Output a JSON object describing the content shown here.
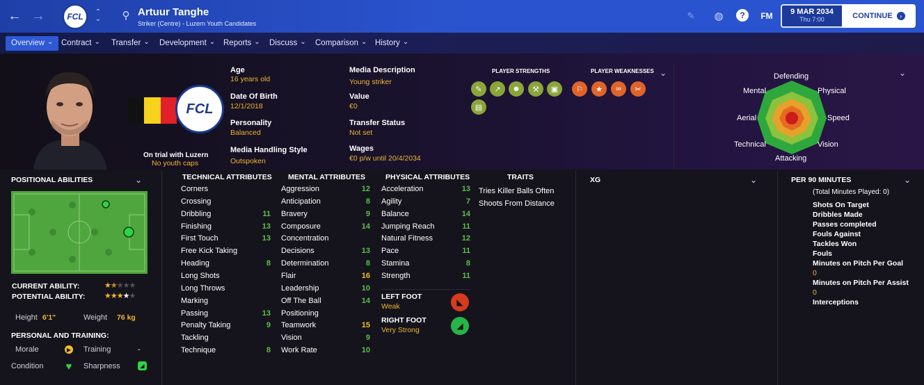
{
  "header": {
    "player_name": "Artuur Tanghe",
    "subtitle": "Striker (Centre) - Luzern Youth Candidates",
    "club_badge_text": "FCL",
    "date": "9 MAR 2034",
    "time": "Thu 7:00",
    "continue_label": "CONTINUE",
    "fm_label": "FM"
  },
  "tabs": [
    "Overview",
    "Contract",
    "Transfer",
    "Development",
    "Reports",
    "Discuss",
    "Comparison",
    "History"
  ],
  "profile": {
    "trial_label": "On trial with Luzern",
    "caps": "No youth caps",
    "age_label": "Age",
    "age": "16 years old",
    "dob_label": "Date Of Birth",
    "dob": "12/1/2018",
    "personality_label": "Personality",
    "personality": "Balanced",
    "media_style_label": "Media Handling Style",
    "media_style": "Outspoken",
    "media_desc_label": "Media Description",
    "media_desc": "Young striker",
    "value_label": "Value",
    "value": "€0",
    "transfer_status_label": "Transfer Status",
    "transfer_status": "Not set",
    "wages_label": "Wages",
    "wages": "€0 p/w until 20/4/2034",
    "strengths_label": "PLAYER STRENGTHS",
    "weaknesses_label": "PLAYER WEAKNESSES"
  },
  "radar": {
    "labels": [
      "Defending",
      "Physical",
      "Speed",
      "Vision",
      "Attacking",
      "Technical",
      "Aerial",
      "Mental"
    ]
  },
  "positional": {
    "title": "POSITIONAL ABILITIES",
    "current_ability_label": "CURRENT ABILITY:",
    "potential_ability_label": "POTENTIAL ABILITY:",
    "current_stars": 1.5,
    "potential_stars": 3.5,
    "height_label": "Height",
    "height": "6'1\"",
    "weight_label": "Weight",
    "weight": "76 kg",
    "personal_title": "PERSONAL AND TRAINING:",
    "morale_label": "Morale",
    "training_label": "Training",
    "training": "-",
    "condition_label": "Condition",
    "sharpness_label": "Sharpness"
  },
  "technical": {
    "title": "TECHNICAL ATTRIBUTES",
    "items": [
      {
        "name": "Corners",
        "value": ""
      },
      {
        "name": "Crossing",
        "value": ""
      },
      {
        "name": "Dribbling",
        "value": "11"
      },
      {
        "name": "Finishing",
        "value": "13"
      },
      {
        "name": "First Touch",
        "value": "13"
      },
      {
        "name": "Free Kick Taking",
        "value": ""
      },
      {
        "name": "Heading",
        "value": "8"
      },
      {
        "name": "Long Shots",
        "value": ""
      },
      {
        "name": "Long Throws",
        "value": ""
      },
      {
        "name": "Marking",
        "value": ""
      },
      {
        "name": "Passing",
        "value": "13"
      },
      {
        "name": "Penalty Taking",
        "value": "9"
      },
      {
        "name": "Tackling",
        "value": ""
      },
      {
        "name": "Technique",
        "value": "8"
      }
    ]
  },
  "mental": {
    "title": "MENTAL ATTRIBUTES",
    "items": [
      {
        "name": "Aggression",
        "value": "12"
      },
      {
        "name": "Anticipation",
        "value": "8"
      },
      {
        "name": "Bravery",
        "value": "9"
      },
      {
        "name": "Composure",
        "value": "14"
      },
      {
        "name": "Concentration",
        "value": ""
      },
      {
        "name": "Decisions",
        "value": "13"
      },
      {
        "name": "Determination",
        "value": "8"
      },
      {
        "name": "Flair",
        "value": "16"
      },
      {
        "name": "Leadership",
        "value": "10"
      },
      {
        "name": "Off The Ball",
        "value": "14"
      },
      {
        "name": "Positioning",
        "value": ""
      },
      {
        "name": "Teamwork",
        "value": "15"
      },
      {
        "name": "Vision",
        "value": "9"
      },
      {
        "name": "Work Rate",
        "value": "10"
      }
    ]
  },
  "physical": {
    "title": "PHYSICAL ATTRIBUTES",
    "items": [
      {
        "name": "Acceleration",
        "value": "13"
      },
      {
        "name": "Agility",
        "value": "7"
      },
      {
        "name": "Balance",
        "value": "14"
      },
      {
        "name": "Jumping Reach",
        "value": "11"
      },
      {
        "name": "Natural Fitness",
        "value": "12"
      },
      {
        "name": "Pace",
        "value": "11"
      },
      {
        "name": "Stamina",
        "value": "8"
      },
      {
        "name": "Strength",
        "value": "11"
      }
    ],
    "left_foot_label": "LEFT FOOT",
    "left_foot": "Weak",
    "right_foot_label": "RIGHT FOOT",
    "right_foot": "Very Strong"
  },
  "traits": {
    "title": "TRAITS",
    "items": [
      "Tries Killer Balls Often",
      "Shoots From Distance"
    ]
  },
  "xg": {
    "title": "XG"
  },
  "per90": {
    "title": "PER 90 MINUTES",
    "total_minutes": "(Total Minutes Played: 0)",
    "stats": [
      {
        "label": "Shots On Target",
        "value": ""
      },
      {
        "label": "Dribbles Made",
        "value": ""
      },
      {
        "label": "Passes completed",
        "value": ""
      },
      {
        "label": "Fouls Against",
        "value": ""
      },
      {
        "label": "Tackles Won",
        "value": ""
      },
      {
        "label": "Fouls",
        "value": ""
      },
      {
        "label": "Minutes on Pitch Per Goal",
        "value": "0"
      },
      {
        "label": "Minutes on Pitch Per Assist",
        "value": "0"
      },
      {
        "label": "Interceptions",
        "value": ""
      }
    ]
  },
  "colors": {
    "accent_blue": "#2a54cf",
    "value_gold": "#f0b431",
    "attr_green": "#5bbf4a",
    "attr_high": "#f0c020",
    "pitch_green": "#4fa63e"
  }
}
